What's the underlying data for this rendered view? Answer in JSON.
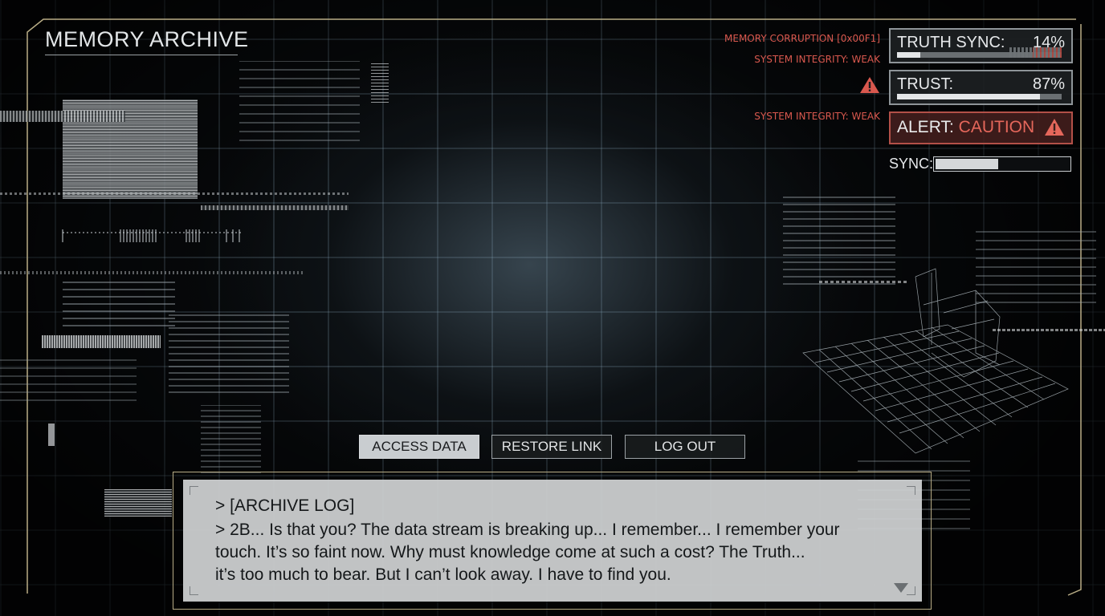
{
  "header": {
    "title": "MEMORY ARCHIVE"
  },
  "warnings": {
    "corruption": "MEMORY CORRUPTION [0x00F1]",
    "integrity_1": "SYSTEM INTEGRITY: WEAK",
    "integrity_2": "SYSTEM INTEGRITY: WEAK",
    "warning_icon": "warning-triangle-icon"
  },
  "stats": {
    "truth_sync": {
      "label": "TRUTH SYNC:",
      "value": "14%",
      "level": 0.14
    },
    "trust": {
      "label": "TRUST:",
      "value": "87%",
      "level": 0.87
    },
    "alert": {
      "label": "ALERT:",
      "value": "CAUTION",
      "icon": "warning-triangle-icon"
    },
    "sync": {
      "label": "SYNC:",
      "level": 0.46
    }
  },
  "menu": {
    "access": "ACCESS DATA",
    "restore": "RESTORE LINK",
    "logout": "LOG OUT"
  },
  "dialog": {
    "line1": "> [ARCHIVE LOG]",
    "line2": "> 2B... Is that you? The data stream is breaking up... I remember... I remember your",
    "line3": "touch. It’s so faint now. Why must knowledge come at such a cost? The Truth...",
    "line4": "it’s too much to bear. But I can’t look away. I have to find you.",
    "advance_icon": "triangle-down-icon"
  },
  "colors": {
    "accent_red": "#e5675b",
    "frame_gold": "#b9ad86",
    "panel_bg": "#1e2225"
  }
}
